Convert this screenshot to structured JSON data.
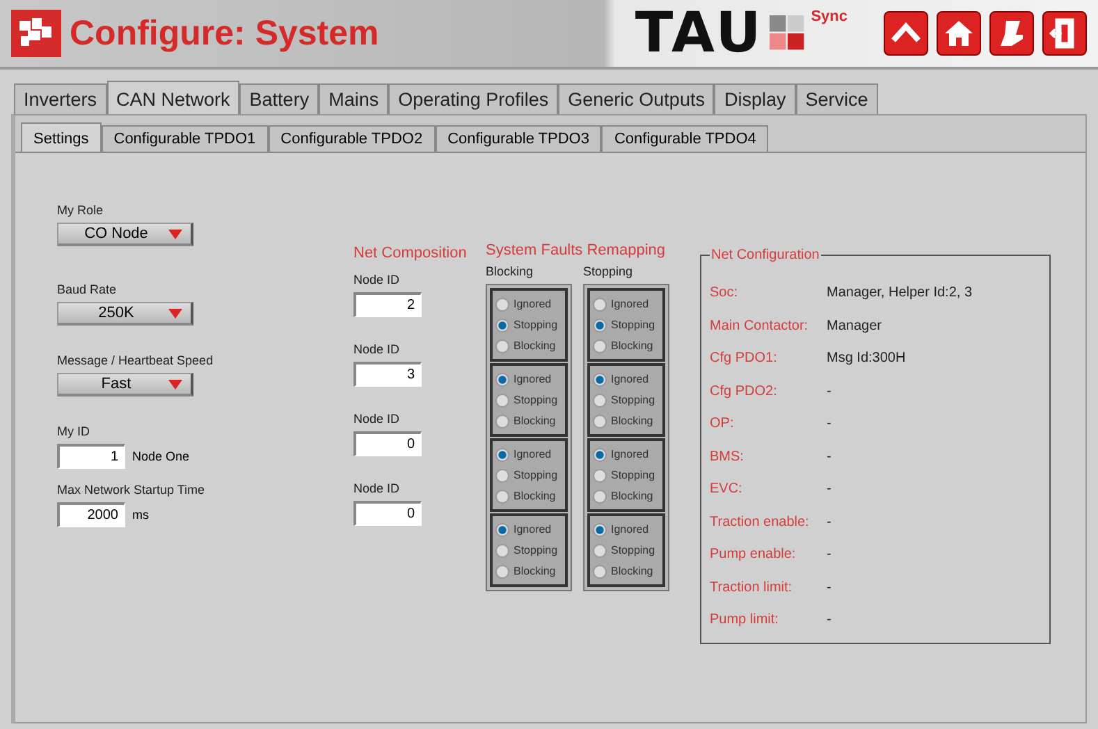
{
  "header": {
    "title": "Configure: System",
    "brand": "TAU",
    "brand_suffix": "Sync",
    "buttons": [
      {
        "kind": "up"
      },
      {
        "kind": "home"
      },
      {
        "kind": "seat"
      },
      {
        "kind": "exit"
      }
    ]
  },
  "tabs": [
    {
      "label": "Inverters",
      "selected": false
    },
    {
      "label": "CAN Network",
      "selected": true
    },
    {
      "label": "Battery",
      "selected": false
    },
    {
      "label": "Mains",
      "selected": false
    },
    {
      "label": "Operating Profiles",
      "selected": false
    },
    {
      "label": "Generic Outputs",
      "selected": false
    },
    {
      "label": "Display",
      "selected": false
    },
    {
      "label": "Service",
      "selected": false
    }
  ],
  "subtabs": [
    {
      "label": "Settings",
      "selected": true
    },
    {
      "label": "Configurable TPDO1",
      "selected": false
    },
    {
      "label": "Configurable TPDO2",
      "selected": false
    },
    {
      "label": "Configurable TPDO3",
      "selected": false
    },
    {
      "label": "Configurable TPDO4",
      "selected": false
    }
  ],
  "settings": {
    "my_role": {
      "label": "My Role",
      "value": "CO Node"
    },
    "baud_rate": {
      "label": "Baud Rate",
      "value": "250K"
    },
    "speed": {
      "label": "Message / Heartbeat Speed",
      "value": "Fast"
    },
    "my_id": {
      "label": "My ID",
      "value": "1",
      "note": "Node One"
    },
    "startup": {
      "label": "Max Network Startup Time",
      "value": "2000",
      "unit": "ms"
    }
  },
  "net_composition": {
    "title": "Net Composition",
    "nodes": [
      {
        "label": "Node ID",
        "value": "2"
      },
      {
        "label": "Node ID",
        "value": "3"
      },
      {
        "label": "Node ID",
        "value": "0"
      },
      {
        "label": "Node ID",
        "value": "0"
      }
    ]
  },
  "faults": {
    "title": "System Faults Remapping",
    "columns": [
      {
        "label": "Blocking",
        "groups": [
          [
            {
              "label": "Ignored",
              "selected": false
            },
            {
              "label": "Stopping",
              "selected": true
            },
            {
              "label": "Blocking",
              "selected": false
            }
          ],
          [
            {
              "label": "Ignored",
              "selected": true
            },
            {
              "label": "Stopping",
              "selected": false
            },
            {
              "label": "Blocking",
              "selected": false
            }
          ],
          [
            {
              "label": "Ignored",
              "selected": true
            },
            {
              "label": "Stopping",
              "selected": false
            },
            {
              "label": "Blocking",
              "selected": false
            }
          ],
          [
            {
              "label": "Ignored",
              "selected": true
            },
            {
              "label": "Stopping",
              "selected": false
            },
            {
              "label": "Blocking",
              "selected": false
            }
          ]
        ]
      },
      {
        "label": "Stopping",
        "groups": [
          [
            {
              "label": "Ignored",
              "selected": false
            },
            {
              "label": "Stopping",
              "selected": true
            },
            {
              "label": "Blocking",
              "selected": false
            }
          ],
          [
            {
              "label": "Ignored",
              "selected": true
            },
            {
              "label": "Stopping",
              "selected": false
            },
            {
              "label": "Blocking",
              "selected": false
            }
          ],
          [
            {
              "label": "Ignored",
              "selected": true
            },
            {
              "label": "Stopping",
              "selected": false
            },
            {
              "label": "Blocking",
              "selected": false
            }
          ],
          [
            {
              "label": "Ignored",
              "selected": true
            },
            {
              "label": "Stopping",
              "selected": false
            },
            {
              "label": "Blocking",
              "selected": false
            }
          ]
        ]
      }
    ]
  },
  "net_configuration": {
    "title": "Net Configuration",
    "rows": [
      {
        "label": "Soc:",
        "value": "Manager, Helper Id:2, 3"
      },
      {
        "label": "Main Contactor:",
        "value": "Manager"
      },
      {
        "label": "Cfg PDO1:",
        "value": "Msg Id:300H"
      },
      {
        "label": "Cfg PDO2:",
        "value": "-"
      },
      {
        "label": "OP:",
        "value": "-"
      },
      {
        "label": "BMS:",
        "value": "-"
      },
      {
        "label": "EVC:",
        "value": "-"
      },
      {
        "label": "Traction enable:",
        "value": "-"
      },
      {
        "label": "Pump enable:",
        "value": "-"
      },
      {
        "label": "Traction limit:",
        "value": "-"
      },
      {
        "label": "Pump limit:",
        "value": "-"
      }
    ]
  }
}
